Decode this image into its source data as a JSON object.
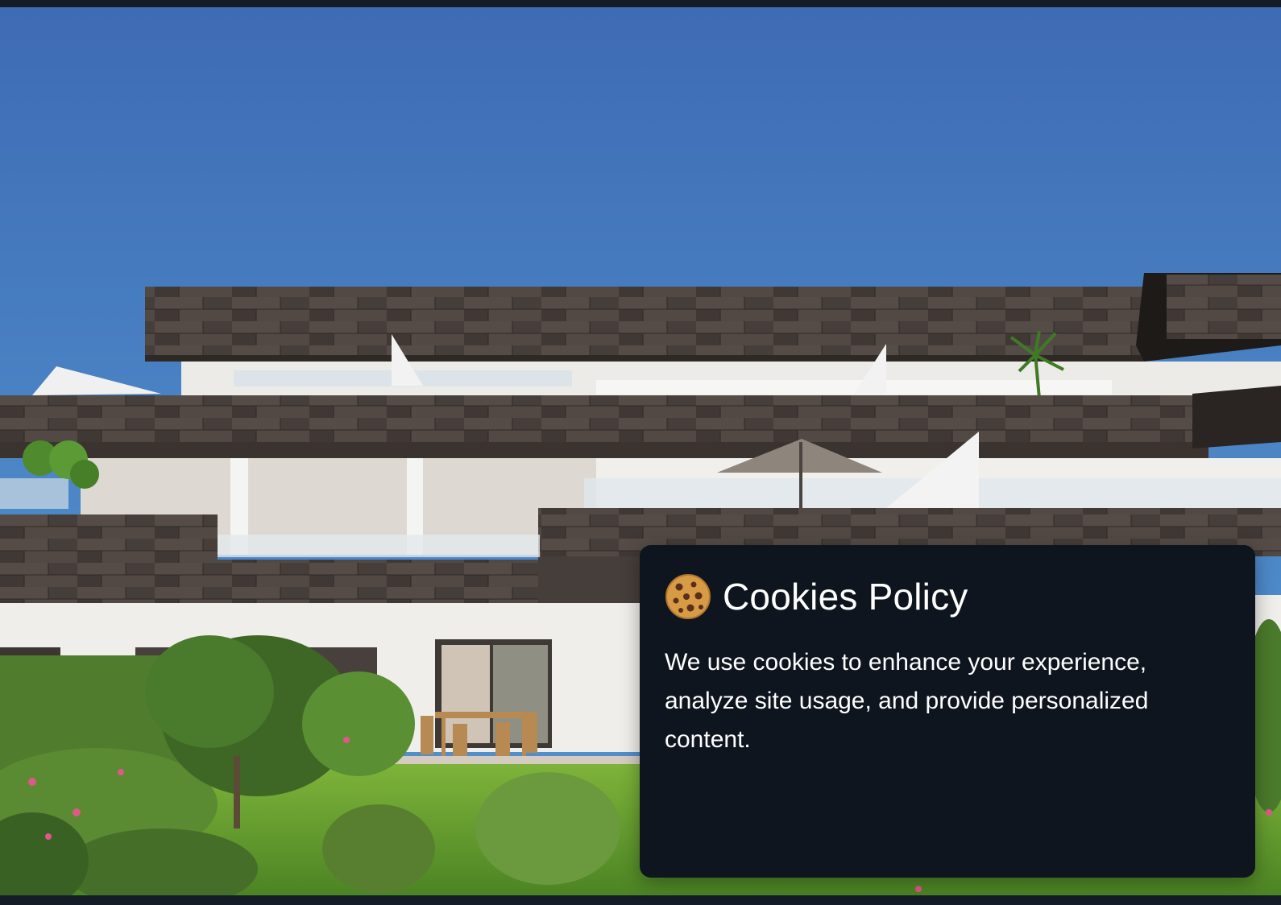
{
  "cookie_banner": {
    "icon": "cookie-icon",
    "title": "Cookies Policy",
    "message": "We use cookies to enhance your experience, analyze site usage, and provide personalized content."
  },
  "colors": {
    "card_background": "#0e151e",
    "page_background": "#0d1219",
    "text": "#ffffff",
    "sky": "#4a81c3"
  }
}
